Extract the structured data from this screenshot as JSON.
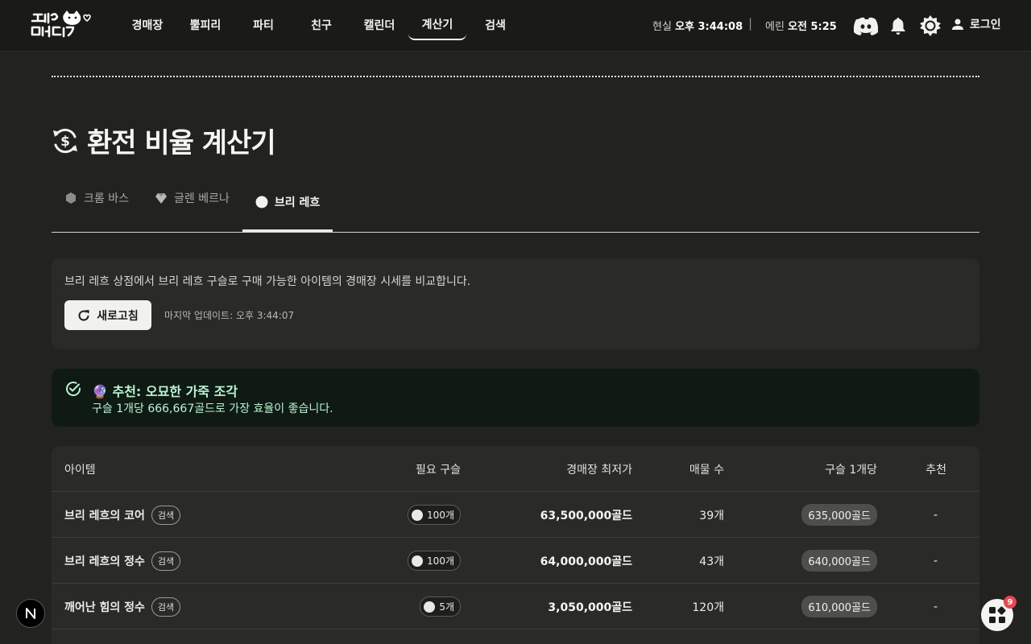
{
  "header": {
    "logo_text": "모두의 마비노기",
    "nav": [
      "경매장",
      "뿔피리",
      "파티",
      "친구",
      "캘린더",
      "계산기",
      "검색"
    ],
    "active_nav": "계산기",
    "clock_real_label": "현실",
    "clock_real_time": "오후 3:44:08",
    "clock_separator": "|",
    "clock_erinn_label": "에린",
    "clock_erinn_time": "오전 5:25",
    "login_label": "로그인"
  },
  "page": {
    "title": "환전 비율 계산기"
  },
  "tabs": [
    {
      "label": "크롬 바스",
      "icon": "hexagon-icon",
      "active": false
    },
    {
      "label": "글렌 베르나",
      "icon": "gem-icon",
      "active": false
    },
    {
      "label": "브리 레흐",
      "icon": "circle-icon",
      "active": true
    }
  ],
  "info": {
    "description": "브리 레흐 상점에서 브리 레흐 구슬로 구매 가능한 아이템의 경매장 시세를 비교합니다.",
    "refresh_label": "새로고침",
    "last_updated": "마지막 업데이트: 오후 3:44:07"
  },
  "recommendation": {
    "title": "🔮 추천: 오묘한 가죽 조각",
    "subtitle": "구슬 1개당 666,667골드로 가장 효율이 좋습니다."
  },
  "table": {
    "columns": [
      "아이템",
      "필요 구슬",
      "경매장 최저가",
      "매물 수",
      "구슬 1개당",
      "추천"
    ],
    "search_chip": "검색",
    "rows": [
      {
        "item": "브리 레흐의 코어",
        "required": "100개",
        "lowest_price": "63,500,000골드",
        "listings": "39개",
        "per_orb": "635,000골드",
        "recommend": "-"
      },
      {
        "item": "브리 레흐의 정수",
        "required": "100개",
        "lowest_price": "64,000,000골드",
        "listings": "43개",
        "per_orb": "640,000골드",
        "recommend": "-"
      },
      {
        "item": "깨어난 힘의 정수",
        "required": "5개",
        "lowest_price": "3,050,000골드",
        "listings": "120개",
        "per_orb": "610,000골드",
        "recommend": "-"
      }
    ]
  },
  "widgets": {
    "notification_count": "9",
    "n_badge": "N"
  },
  "colors": {
    "background": "#22221f",
    "header": "#1a1a18",
    "card": "#2a2a27",
    "recommend_bg": "#0f1a14",
    "recommend_text": "#b9f5d2",
    "badge": "#e5484d"
  }
}
